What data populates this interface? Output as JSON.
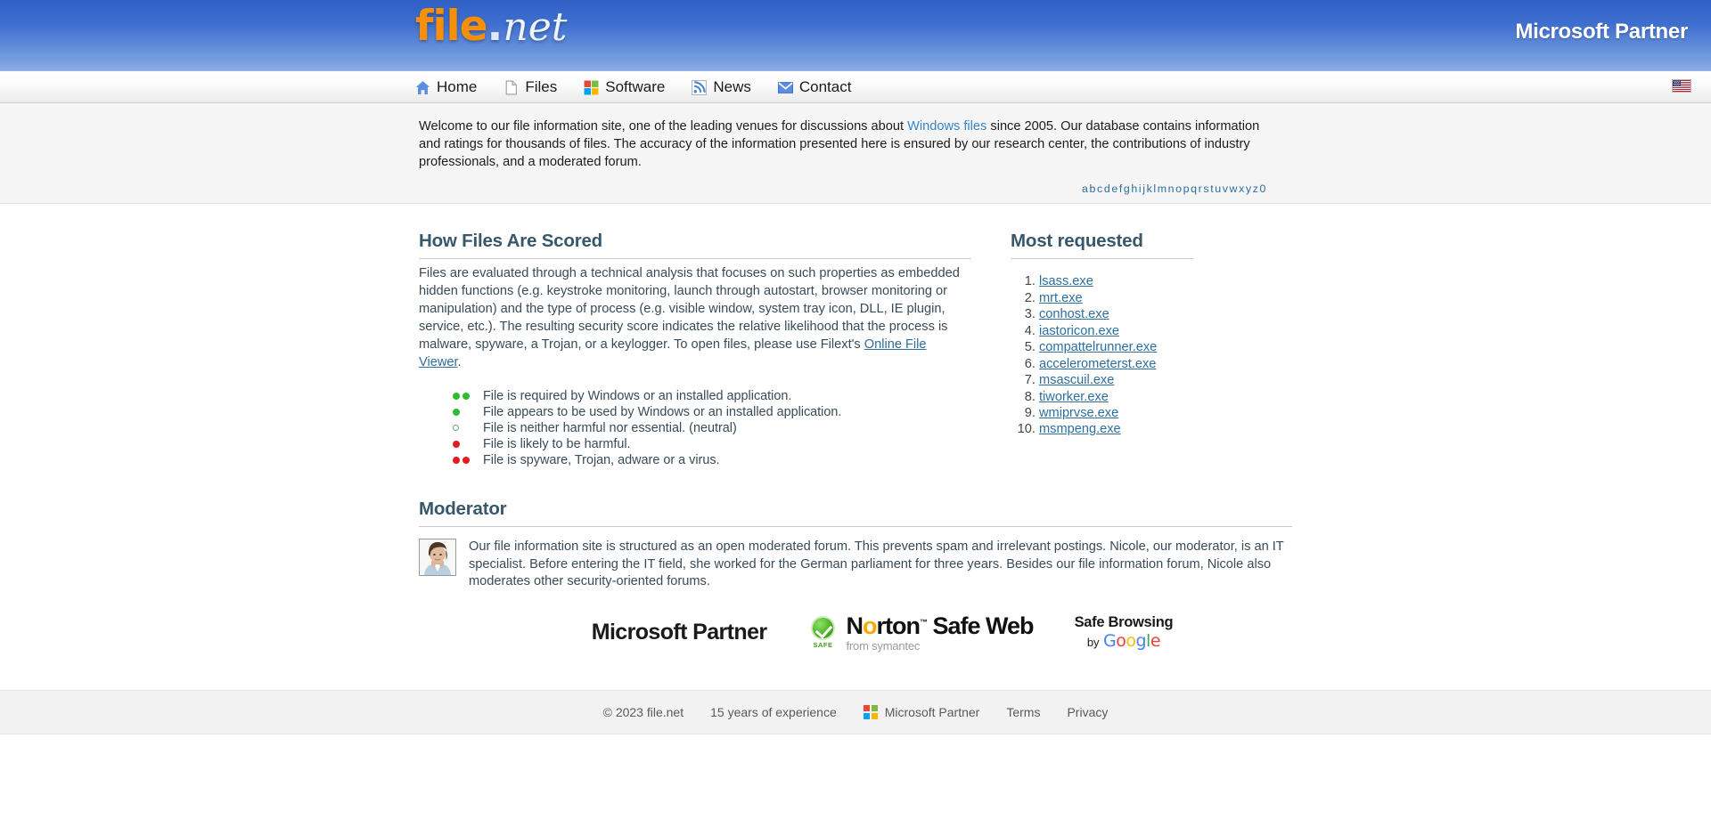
{
  "header": {
    "logo_file": "file",
    "logo_dot": ".",
    "logo_net": "net",
    "partner_badge": "Microsoft Partner"
  },
  "nav": {
    "items": [
      {
        "label": "Home",
        "icon": "home-icon"
      },
      {
        "label": "Files",
        "icon": "document-icon"
      },
      {
        "label": "Software",
        "icon": "microsoft-logo-icon"
      },
      {
        "label": "News",
        "icon": "rss-icon"
      },
      {
        "label": "Contact",
        "icon": "envelope-icon"
      }
    ],
    "language_flag": "us-flag-icon"
  },
  "intro": {
    "part1": "Welcome to our file information site, one of the leading venues for discussions about ",
    "link": "Windows files",
    "part2": " since 2005. Our database contains information and ratings for thousands of files. The accuracy of the information presented here is ensured by our research center, the contributions of industry professionals, and a moderated forum.",
    "alphabet": [
      "a",
      "b",
      "c",
      "d",
      "e",
      "f",
      "g",
      "h",
      "i",
      "j",
      "k",
      "l",
      "m",
      "n",
      "o",
      "p",
      "q",
      "r",
      "s",
      "t",
      "u",
      "v",
      "w",
      "x",
      "y",
      "z",
      "0"
    ]
  },
  "scoring": {
    "heading": "How Files Are Scored",
    "paragraph_part1": "Files are evaluated through a technical analysis that focuses on such properties as embedded hidden functions (e.g. keystroke monitoring, launch through autostart, browser monitoring or manipulation) and the type of process (e.g. visible window, system tray icon, DLL, IE plugin, service, etc.). The resulting security score indicates the relative likelihood that the process is malware, spyware, a Trojan, or a keylogger. To open files, please use Filext's ",
    "paragraph_link": "Online File Viewer",
    "paragraph_part2": ".",
    "legend": [
      {
        "marker": "two-green-dots",
        "text": "File is required by Windows or an installed application."
      },
      {
        "marker": "one-green-dot",
        "text": "File appears to be used by Windows or an installed application."
      },
      {
        "marker": "hollow-circle",
        "text": "File is neither harmful nor essential. (neutral)"
      },
      {
        "marker": "one-red-dot",
        "text": "File is likely to be harmful."
      },
      {
        "marker": "two-red-dots",
        "text": "File is spyware, Trojan, adware or a virus."
      }
    ]
  },
  "most_requested": {
    "heading": "Most requested",
    "items": [
      "lsass.exe",
      "mrt.exe",
      "conhost.exe",
      "iastoricon.exe",
      "compattelrunner.exe",
      "accelerometerst.exe",
      "msascuil.exe",
      "tiworker.exe",
      "wmiprvse.exe",
      "msmpeng.exe"
    ]
  },
  "moderator": {
    "heading": "Moderator",
    "avatar": "moderator-portrait",
    "text": "Our file information site is structured as an open moderated forum. This prevents spam and irrelevant postings. Nicole, our moderator, is an IT specialist. Before entering the IT field, she worked for the German parliament for three years. Besides our file information forum, Nicole also moderates other security-oriented forums."
  },
  "badges": {
    "microsoft_partner": "Microsoft Partner",
    "norton": {
      "seal_label": "SAFE",
      "name_part1": "N",
      "name_o": "o",
      "name_part2": "rton",
      "trademark": "™",
      "safe_web": "Safe Web",
      "subtitle": "from symantec"
    },
    "google": {
      "line1": "Safe Browsing",
      "by": "by",
      "g1": "G",
      "g2": "o",
      "g3": "o",
      "g4": "g",
      "g5": "l",
      "g6": "e"
    }
  },
  "footer": {
    "copyright": "© 2023 file.net",
    "experience": "15 years of experience",
    "partner": "Microsoft Partner",
    "terms": "Terms",
    "privacy": "Privacy"
  },
  "colors": {
    "header_blue": "#3f6fcf",
    "logo_orange": "#f79008",
    "link_blue": "#2c6e9e",
    "intro_link_blue": "#3585c6",
    "heading_slate": "#38576b",
    "green_dot": "#2fbd2f",
    "red_dot": "#e41b1b",
    "band_gray": "#f5f5f5",
    "footer_gray": "#f2f2f2"
  }
}
